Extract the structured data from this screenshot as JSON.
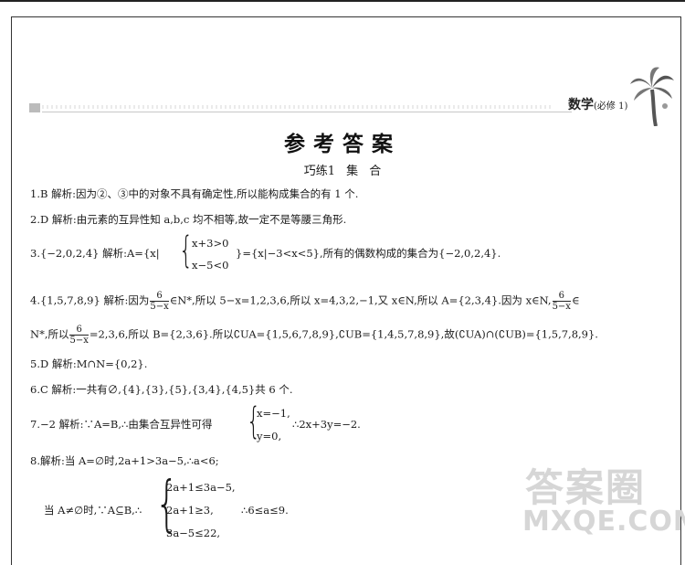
{
  "header": {
    "subject": "数学",
    "subject_note": "(必修 1)"
  },
  "title": "参考答案",
  "section": "巧练1  集  合",
  "answers": {
    "a1": "1.B  解析:因为②、③中的对象不具有确定性,所以能构成集合的有 1 个.",
    "a2": "2.D  解析:由元素的互异性知 a,b,c 均不相等,故一定不是等腰三角形.",
    "a3_pre": "3.{−2,0,2,4}  解析:A={x|",
    "a3_row1": "x+3>0",
    "a3_row2": "x−5<0",
    "a3_post": "}={x|−3<x<5},所有的偶数构成的集合为{−2,0,2,4}.",
    "a4_l1_pre": "4.{1,5,7,8,9}  解析:因为",
    "a4_frac_num": "6",
    "a4_frac_den": "5−x",
    "a4_l1_mid": "∈N*,所以 5−x=1,2,3,6,所以 x=4,3,2,−1,又 x∈N,所以 A={2,3,4}.因为 x∈N,",
    "a4_l1_end": "∈",
    "a4_l2_pre": "N*,所以",
    "a4_l2_post": "=2,3,6,所以 B={2,3,6}.所以∁UA={1,5,6,7,8,9},∁UB={1,4,5,7,8,9},故(∁UA)∩(∁UB)={1,5,7,8,9}.",
    "a5": "5.D  解析:M∩N={0,2}.",
    "a6": "6.C  解析:一共有∅,{4},{3},{5},{3,4},{4,5}共 6 个.",
    "a7_pre": "7.−2  解析:∵A=B,∴由集合互异性可得",
    "a7_row1": "x=−1,",
    "a7_row2": "y=0,",
    "a7_post": "∴2x+3y=−2.",
    "a8_l1": "8.解析:当 A=∅时,2a+1>3a−5,∴a<6;",
    "a8_l2_pre": "当 A≠∅时,∵A⊆B,∴",
    "a8_row1": "2a+1≤3a−5,",
    "a8_row2": "2a+1≥3,",
    "a8_row3": "3a−5≤22,",
    "a8_l2_post": "∴6≤a≤9."
  },
  "watermark": {
    "line1": "答案圈",
    "line2": "MXQE.COM"
  }
}
